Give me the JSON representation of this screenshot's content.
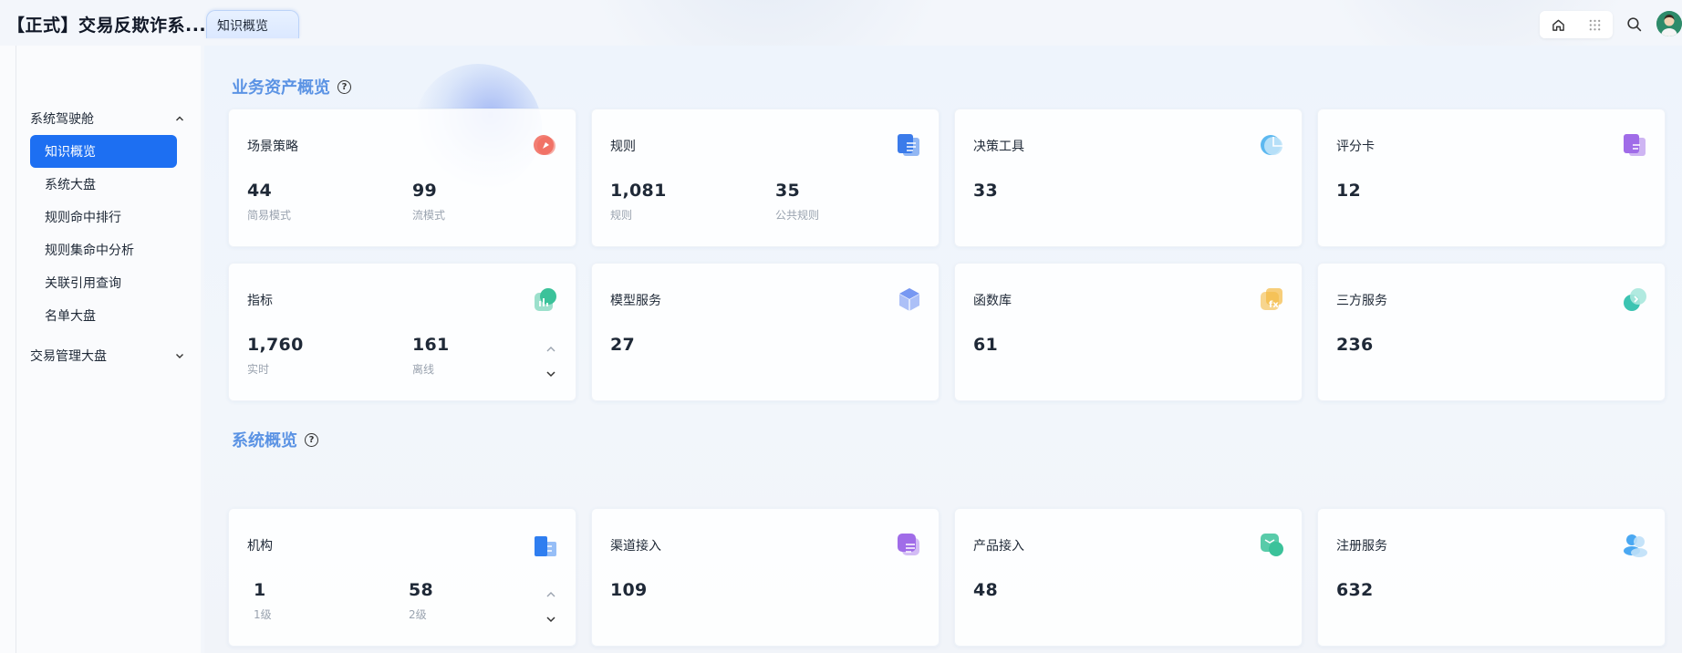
{
  "app": {
    "title": "【正式】交易反欺诈系..."
  },
  "tabs": [
    {
      "label": "知识概览"
    }
  ],
  "sidebar": {
    "groups": [
      {
        "label": "系统驾驶舱",
        "expanded": true,
        "items": [
          {
            "label": "知识概览",
            "active": true
          },
          {
            "label": "系统大盘"
          },
          {
            "label": "规则命中排行"
          },
          {
            "label": "规则集命中分析"
          },
          {
            "label": "关联引用查询"
          },
          {
            "label": "名单大盘"
          }
        ]
      },
      {
        "label": "交易管理大盘",
        "expanded": false
      }
    ]
  },
  "sections": [
    {
      "title": "业务资产概览",
      "cards": [
        {
          "title": "场景策略",
          "icon": "compass-icon",
          "color": "#f0675b",
          "stats": [
            {
              "value": "44",
              "label": "简易模式"
            },
            {
              "value": "99",
              "label": "流模式"
            }
          ]
        },
        {
          "title": "规则",
          "icon": "list-doc-icon",
          "color": "#3b7bea",
          "stats": [
            {
              "value": "1,081",
              "label": "规则"
            },
            {
              "value": "35",
              "label": "公共规则"
            }
          ]
        },
        {
          "title": "决策工具",
          "icon": "pie-icon",
          "color": "#5cb8f0",
          "stats": [
            {
              "value": "33",
              "label": ""
            }
          ]
        },
        {
          "title": "评分卡",
          "icon": "scorecard-icon",
          "color": "#a06ce8",
          "stats": [
            {
              "value": "12",
              "label": ""
            }
          ]
        },
        {
          "title": "指标",
          "icon": "bar-chart-icon",
          "color": "#3bc29a",
          "stats": [
            {
              "value": "1,760",
              "label": "实时"
            },
            {
              "value": "161",
              "label": "离线"
            }
          ],
          "updown": true
        },
        {
          "title": "模型服务",
          "icon": "cube-icon",
          "color": "#6a8df0",
          "stats": [
            {
              "value": "27",
              "label": ""
            }
          ]
        },
        {
          "title": "函数库",
          "icon": "fx-icon",
          "color": "#f4b942",
          "stats": [
            {
              "value": "61",
              "label": ""
            }
          ]
        },
        {
          "title": "三方服务",
          "icon": "link-icon",
          "color": "#3cc4b2",
          "stats": [
            {
              "value": "236",
              "label": ""
            }
          ]
        }
      ]
    },
    {
      "title": "系统概览",
      "cards": [
        {
          "title": "机构",
          "icon": "building-icon",
          "color": "#2f7ef0",
          "stats": [
            {
              "value": "1",
              "label": "1级"
            },
            {
              "value": "58",
              "label": "2级"
            }
          ],
          "updown": true
        },
        {
          "title": "渠道接入",
          "icon": "channel-icon",
          "color": "#a06ce8",
          "stats": [
            {
              "value": "109",
              "label": ""
            }
          ]
        },
        {
          "title": "产品接入",
          "icon": "product-icon",
          "color": "#3bc29a",
          "stats": [
            {
              "value": "48",
              "label": ""
            }
          ]
        },
        {
          "title": "注册服务",
          "icon": "users-icon",
          "color": "#4aa8f2",
          "stats": [
            {
              "value": "632",
              "label": ""
            }
          ]
        }
      ]
    }
  ]
}
